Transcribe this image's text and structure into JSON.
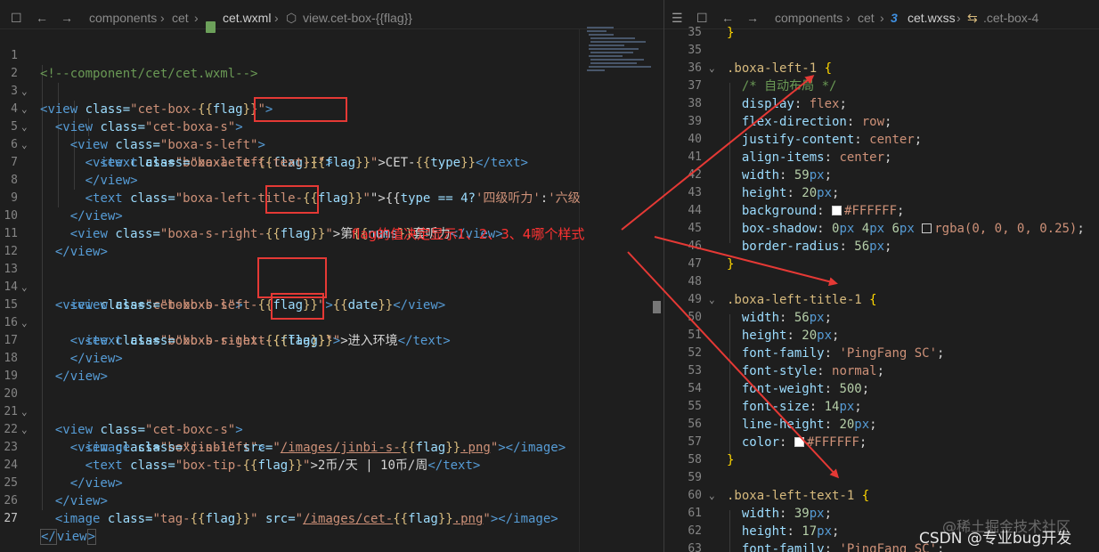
{
  "left": {
    "breadcrumb": {
      "seg1": "components",
      "sep": "›",
      "seg2": "cet",
      "file": "cet.wxml",
      "node": "view.cet-box-{{flag}}"
    },
    "lines": [
      {
        "n": "1"
      },
      {
        "n": "2"
      },
      {
        "n": "3"
      },
      {
        "n": "4"
      },
      {
        "n": "5"
      },
      {
        "n": "6"
      },
      {
        "n": "7"
      },
      {
        "n": "8"
      },
      {
        "n": "9"
      },
      {
        "n": "10"
      },
      {
        "n": "11"
      },
      {
        "n": "12"
      },
      {
        "n": "13"
      },
      {
        "n": "14"
      },
      {
        "n": "15"
      },
      {
        "n": "16"
      },
      {
        "n": "17"
      },
      {
        "n": "18"
      },
      {
        "n": "19"
      },
      {
        "n": "20"
      },
      {
        "n": "21"
      },
      {
        "n": "22"
      },
      {
        "n": "23"
      },
      {
        "n": "24"
      },
      {
        "n": "25"
      },
      {
        "n": "26"
      },
      {
        "n": "27"
      }
    ],
    "code": {
      "l1": "<!--component/cet/cet.wxml-->",
      "cls": "class=",
      "view": "view",
      "text": "text",
      "image": "image",
      "src": "src=",
      "flag": "flag",
      "type": "type",
      "nums": "nums",
      "date": "date",
      "v_cetbox": "\"cet-box-",
      "v_boxas": "\"cet-boxa-s\"",
      "v_boxasleft": "\"boxa-s-left\"",
      "v_boxaleft": "\"boxa-left-",
      "v_boxalefttext": "\"boxa-left-text-",
      "t_cet": ">CET-",
      "v_boxalefttitle": "\"boxa-left-title-",
      "t_l8_mid": "\">{{",
      "t_l8_expr": "type == 4?",
      "t_l8_s1": "'四级听力'",
      "t_l8_colon": ":",
      "t_l8_s2": "'六级",
      "v_boxasright": "\"boxa-s-right-",
      "t_di": ">第",
      "t_taoting": "套听力",
      "v_boxbs": "\"cet-boxb-s\"",
      "v_boxbsleft": "\"boxb-s-left-",
      "v_boxbsright": "\"boxb-s-right-",
      "v_boxbstext": "\"boxb-s-text-",
      "t_huanjing": ">进入环境",
      "v_boxcs": "\"cet-boxc-s\"",
      "v_boxcsleft": "\"boxc-s-left\"",
      "v_jinbi": "\"jinbi\"",
      "v_src1": "/images/jinbi-s-",
      "v_png": ".png",
      "v_boxtip": "\"box-tip-",
      "t_bi": ">2币/天 | 10币/周",
      "v_tag": "\"tag-",
      "v_src2": "/images/cet-"
    }
  },
  "right": {
    "breadcrumb": {
      "seg1": "components",
      "sep": "›",
      "seg2": "cet",
      "file": "cet.wxss",
      "node": ".cet-box-4"
    },
    "lines": [
      "35",
      "36",
      "37",
      "38",
      "39",
      "40",
      "41",
      "42",
      "43",
      "44",
      "45",
      "46",
      "47",
      "48",
      "49",
      "50",
      "51",
      "52",
      "53",
      "54",
      "55",
      "56",
      "57",
      "58",
      "59",
      "60",
      "61",
      "62",
      "63"
    ],
    "css": {
      "sel1": ".boxa-left-1",
      "comment": "/* 自动布局 */",
      "p_display": "display",
      "v_display": "flex",
      "p_fd": "flex-direction",
      "v_fd": "row",
      "p_jc": "justify-content",
      "v_jc": "center",
      "p_ai": "align-items",
      "v_ai": "center",
      "p_w": "width",
      "v_w1": "59",
      "v_w2": "56",
      "v_w3": "39",
      "p_h": "height",
      "v_h1": "20",
      "v_h2": "20",
      "v_h3": "17",
      "p_bg": "background",
      "v_bg": "#FFFFFF",
      "p_bs": "box-shadow",
      "v_bs_a": "0",
      "v_bs_b": "4",
      "v_bs_c": "6",
      "v_bs_fn": "rgba(0, 0, 0, 0.25)",
      "p_br": "border-radius",
      "v_br": "56",
      "sel2": ".boxa-left-title-1",
      "p_ff": "font-family",
      "v_ff": "'PingFang SC'",
      "p_fs": "font-style",
      "v_fs": "normal",
      "p_fw": "font-weight",
      "v_fw": "500",
      "p_fz": "font-size",
      "v_fz": "14",
      "p_lh": "line-height",
      "v_lh": "20",
      "p_col": "color",
      "v_col": "#FFFFFF",
      "sel3": ".boxa-left-text-1",
      "unit": "px"
    }
  },
  "annotation": "flag的值决定显示1、2、3、4哪个样式",
  "watermark": {
    "juejin": "@稀土掘金技术社区",
    "csdn": "CSDN @专业bug开发"
  },
  "colors": {
    "annotation_red": "#e53935",
    "background": "#1e1e1e"
  }
}
